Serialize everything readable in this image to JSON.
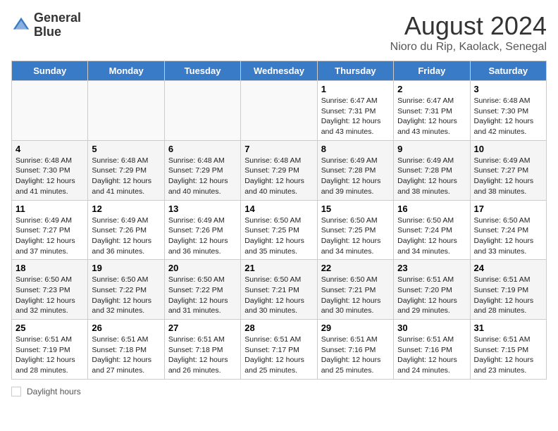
{
  "header": {
    "logo_line1": "General",
    "logo_line2": "Blue",
    "title": "August 2024",
    "subtitle": "Nioro du Rip, Kaolack, Senegal"
  },
  "days_of_week": [
    "Sunday",
    "Monday",
    "Tuesday",
    "Wednesday",
    "Thursday",
    "Friday",
    "Saturday"
  ],
  "footer": {
    "daylight_label": "Daylight hours"
  },
  "weeks": [
    [
      {
        "num": "",
        "info": ""
      },
      {
        "num": "",
        "info": ""
      },
      {
        "num": "",
        "info": ""
      },
      {
        "num": "",
        "info": ""
      },
      {
        "num": "1",
        "info": "Sunrise: 6:47 AM\nSunset: 7:31 PM\nDaylight: 12 hours and 43 minutes."
      },
      {
        "num": "2",
        "info": "Sunrise: 6:47 AM\nSunset: 7:31 PM\nDaylight: 12 hours and 43 minutes."
      },
      {
        "num": "3",
        "info": "Sunrise: 6:48 AM\nSunset: 7:30 PM\nDaylight: 12 hours and 42 minutes."
      }
    ],
    [
      {
        "num": "4",
        "info": "Sunrise: 6:48 AM\nSunset: 7:30 PM\nDaylight: 12 hours and 41 minutes."
      },
      {
        "num": "5",
        "info": "Sunrise: 6:48 AM\nSunset: 7:29 PM\nDaylight: 12 hours and 41 minutes."
      },
      {
        "num": "6",
        "info": "Sunrise: 6:48 AM\nSunset: 7:29 PM\nDaylight: 12 hours and 40 minutes."
      },
      {
        "num": "7",
        "info": "Sunrise: 6:48 AM\nSunset: 7:29 PM\nDaylight: 12 hours and 40 minutes."
      },
      {
        "num": "8",
        "info": "Sunrise: 6:49 AM\nSunset: 7:28 PM\nDaylight: 12 hours and 39 minutes."
      },
      {
        "num": "9",
        "info": "Sunrise: 6:49 AM\nSunset: 7:28 PM\nDaylight: 12 hours and 38 minutes."
      },
      {
        "num": "10",
        "info": "Sunrise: 6:49 AM\nSunset: 7:27 PM\nDaylight: 12 hours and 38 minutes."
      }
    ],
    [
      {
        "num": "11",
        "info": "Sunrise: 6:49 AM\nSunset: 7:27 PM\nDaylight: 12 hours and 37 minutes."
      },
      {
        "num": "12",
        "info": "Sunrise: 6:49 AM\nSunset: 7:26 PM\nDaylight: 12 hours and 36 minutes."
      },
      {
        "num": "13",
        "info": "Sunrise: 6:49 AM\nSunset: 7:26 PM\nDaylight: 12 hours and 36 minutes."
      },
      {
        "num": "14",
        "info": "Sunrise: 6:50 AM\nSunset: 7:25 PM\nDaylight: 12 hours and 35 minutes."
      },
      {
        "num": "15",
        "info": "Sunrise: 6:50 AM\nSunset: 7:25 PM\nDaylight: 12 hours and 34 minutes."
      },
      {
        "num": "16",
        "info": "Sunrise: 6:50 AM\nSunset: 7:24 PM\nDaylight: 12 hours and 34 minutes."
      },
      {
        "num": "17",
        "info": "Sunrise: 6:50 AM\nSunset: 7:24 PM\nDaylight: 12 hours and 33 minutes."
      }
    ],
    [
      {
        "num": "18",
        "info": "Sunrise: 6:50 AM\nSunset: 7:23 PM\nDaylight: 12 hours and 32 minutes."
      },
      {
        "num": "19",
        "info": "Sunrise: 6:50 AM\nSunset: 7:22 PM\nDaylight: 12 hours and 32 minutes."
      },
      {
        "num": "20",
        "info": "Sunrise: 6:50 AM\nSunset: 7:22 PM\nDaylight: 12 hours and 31 minutes."
      },
      {
        "num": "21",
        "info": "Sunrise: 6:50 AM\nSunset: 7:21 PM\nDaylight: 12 hours and 30 minutes."
      },
      {
        "num": "22",
        "info": "Sunrise: 6:50 AM\nSunset: 7:21 PM\nDaylight: 12 hours and 30 minutes."
      },
      {
        "num": "23",
        "info": "Sunrise: 6:51 AM\nSunset: 7:20 PM\nDaylight: 12 hours and 29 minutes."
      },
      {
        "num": "24",
        "info": "Sunrise: 6:51 AM\nSunset: 7:19 PM\nDaylight: 12 hours and 28 minutes."
      }
    ],
    [
      {
        "num": "25",
        "info": "Sunrise: 6:51 AM\nSunset: 7:19 PM\nDaylight: 12 hours and 28 minutes."
      },
      {
        "num": "26",
        "info": "Sunrise: 6:51 AM\nSunset: 7:18 PM\nDaylight: 12 hours and 27 minutes."
      },
      {
        "num": "27",
        "info": "Sunrise: 6:51 AM\nSunset: 7:18 PM\nDaylight: 12 hours and 26 minutes."
      },
      {
        "num": "28",
        "info": "Sunrise: 6:51 AM\nSunset: 7:17 PM\nDaylight: 12 hours and 25 minutes."
      },
      {
        "num": "29",
        "info": "Sunrise: 6:51 AM\nSunset: 7:16 PM\nDaylight: 12 hours and 25 minutes."
      },
      {
        "num": "30",
        "info": "Sunrise: 6:51 AM\nSunset: 7:16 PM\nDaylight: 12 hours and 24 minutes."
      },
      {
        "num": "31",
        "info": "Sunrise: 6:51 AM\nSunset: 7:15 PM\nDaylight: 12 hours and 23 minutes."
      }
    ]
  ]
}
